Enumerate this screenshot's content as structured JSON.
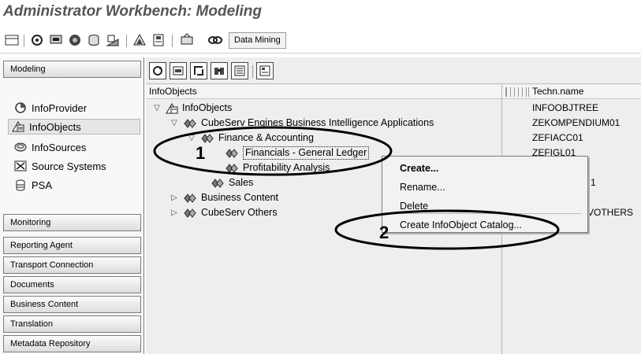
{
  "window": {
    "title": "Administrator Workbench: Modeling"
  },
  "toolbar": {
    "data_mining_label": "Data Mining"
  },
  "nav": {
    "modeling_header": "Modeling",
    "items": [
      {
        "label": "InfoProvider",
        "icon": "infoprovider-icon"
      },
      {
        "label": "InfoObjects",
        "icon": "infoobjects-icon"
      },
      {
        "label": "InfoSources",
        "icon": "infosources-icon"
      },
      {
        "label": "Source Systems",
        "icon": "source-systems-icon"
      },
      {
        "label": "PSA",
        "icon": "psa-icon"
      }
    ],
    "sections": [
      "Monitoring",
      "Reporting Agent",
      "Transport Connection",
      "Documents",
      "Business Content",
      "Translation",
      "Metadata Repository"
    ]
  },
  "tree": {
    "col_infoobjects": "InfoObjects",
    "col_techn_name": "Techn.name",
    "rows": [
      {
        "label": "InfoObjects",
        "tech": "INFOOBJTREE"
      },
      {
        "label": "CubeServ Engines Business Intelligence Applications",
        "tech": "ZEKOMPENDIUM01"
      },
      {
        "label": "Finance & Accounting",
        "tech": "ZEFIACC01"
      },
      {
        "label": "Financials - General Ledger",
        "tech": "ZEFIGL01"
      },
      {
        "label": "Profitability Analysis",
        "tech": ""
      },
      {
        "label": "Sales",
        "tech": "1"
      },
      {
        "label": "Business Content",
        "tech": ""
      },
      {
        "label": "CubeServ Others",
        "tech": "VOTHERS"
      }
    ]
  },
  "context_menu": {
    "items": [
      "Create...",
      "Rename...",
      "Delete",
      "Create InfoObject Catalog..."
    ]
  },
  "callouts": [
    "1",
    "2"
  ]
}
